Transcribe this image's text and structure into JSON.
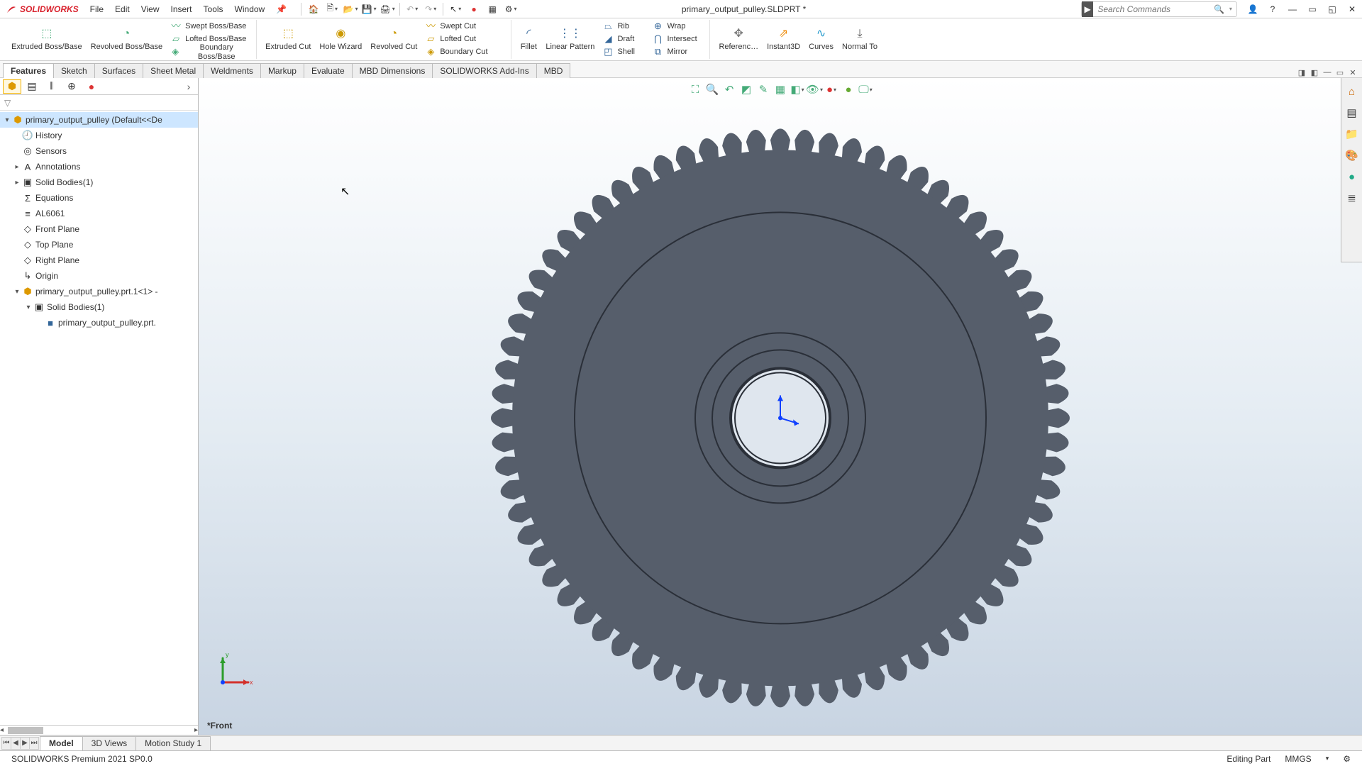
{
  "app": {
    "name": "SOLIDWORKS",
    "doc_title": "primary_output_pulley.SLDPRT *"
  },
  "menu": [
    "File",
    "Edit",
    "View",
    "Insert",
    "Tools",
    "Window"
  ],
  "search": {
    "placeholder": "Search Commands"
  },
  "ribbon": {
    "extruded_boss": "Extruded Boss/Base",
    "revolved_boss": "Revolved Boss/Base",
    "swept_boss": "Swept Boss/Base",
    "lofted_boss": "Lofted Boss/Base",
    "boundary_boss": "Boundary Boss/Base",
    "extruded_cut": "Extruded Cut",
    "hole_wizard": "Hole Wizard",
    "revolved_cut": "Revolved Cut",
    "swept_cut": "Swept Cut",
    "lofted_cut": "Lofted Cut",
    "boundary_cut": "Boundary Cut",
    "fillet": "Fillet",
    "linear_pattern": "Linear Pattern",
    "rib": "Rib",
    "draft": "Draft",
    "shell": "Shell",
    "wrap": "Wrap",
    "intersect": "Intersect",
    "mirror": "Mirror",
    "ref_geom": "Referenc…",
    "instant3d": "Instant3D",
    "curves": "Curves",
    "normal_to": "Normal To"
  },
  "ftabs": [
    "Features",
    "Sketch",
    "Surfaces",
    "Sheet Metal",
    "Weldments",
    "Markup",
    "Evaluate",
    "MBD Dimensions",
    "SOLIDWORKS Add-Ins",
    "MBD"
  ],
  "ftab_active": 0,
  "tree": {
    "root": "primary_output_pulley  (Default<<De",
    "nodes": [
      {
        "lbl": "History",
        "ico": "📁",
        "ind": 1
      },
      {
        "lbl": "Sensors",
        "ico": "◎",
        "ind": 1
      },
      {
        "lbl": "Annotations",
        "ico": "A",
        "ind": 1,
        "exp": "▸"
      },
      {
        "lbl": "Solid Bodies(1)",
        "ico": "▣",
        "ind": 1,
        "exp": "▸"
      },
      {
        "lbl": "Equations",
        "ico": "Σ",
        "ind": 1
      },
      {
        "lbl": "AL6061",
        "ico": "≡",
        "ind": 1
      },
      {
        "lbl": "Front Plane",
        "ico": "◇",
        "ind": 1
      },
      {
        "lbl": "Top Plane",
        "ico": "◇",
        "ind": 1
      },
      {
        "lbl": "Right Plane",
        "ico": "◇",
        "ind": 1
      },
      {
        "lbl": "Origin",
        "ico": "↳",
        "ind": 1
      },
      {
        "lbl": "primary_output_pulley.prt.1<1> -",
        "ico": "⬢",
        "ind": 1,
        "exp": "▾"
      },
      {
        "lbl": "Solid Bodies(1)",
        "ico": "▣",
        "ind": 2,
        "exp": "▾"
      },
      {
        "lbl": "primary_output_pulley.prt.",
        "ico": "■",
        "ind": 3
      }
    ]
  },
  "view_label": "*Front",
  "btabs": [
    "Model",
    "3D Views",
    "Motion Study 1"
  ],
  "btab_active": 0,
  "status": {
    "left": "SOLIDWORKS Premium 2021 SP0.0",
    "mode": "Editing Part",
    "units": "MMGS"
  }
}
